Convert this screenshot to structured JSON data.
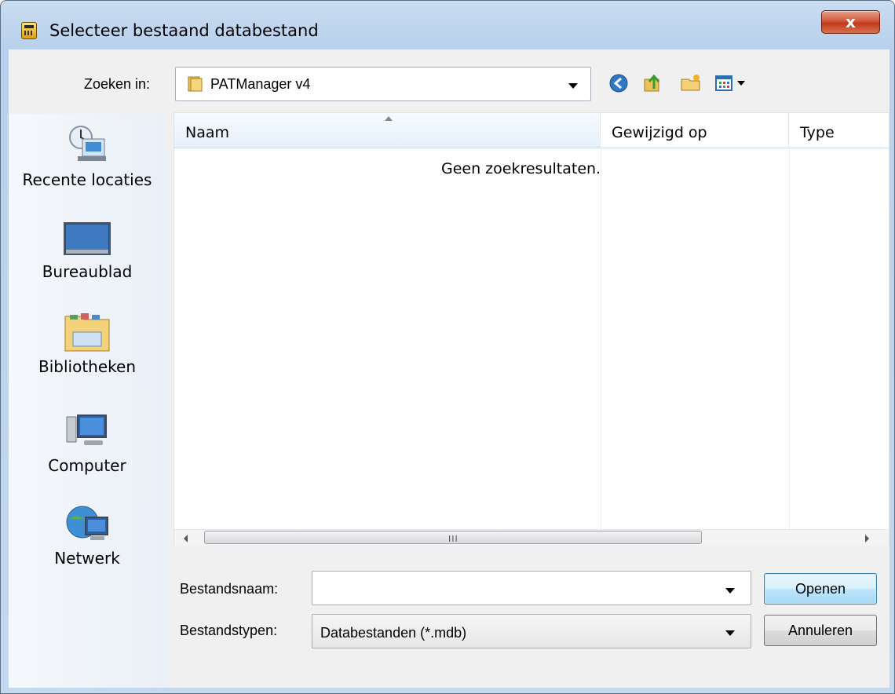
{
  "window": {
    "title": "Selecteer bestaand databestand",
    "close_label": "x"
  },
  "toolbar": {
    "lookin_label": "Zoeken in:",
    "lookin_value": "PATManager v4",
    "icons": [
      "back-icon",
      "up-folder-icon",
      "new-folder-icon",
      "view-menu-icon"
    ]
  },
  "places": [
    {
      "label": "Recente locaties",
      "icon": "recent-places-icon"
    },
    {
      "label": "Bureaublad",
      "icon": "desktop-icon"
    },
    {
      "label": "Bibliotheken",
      "icon": "libraries-icon"
    },
    {
      "label": "Computer",
      "icon": "computer-icon"
    },
    {
      "label": "Netwerk",
      "icon": "network-icon"
    }
  ],
  "list": {
    "columns": [
      "Naam",
      "Gewijzigd op",
      "Type"
    ],
    "sorted_column": "Naam",
    "empty_message": "Geen zoekresultaten.",
    "scroll_grip": "III"
  },
  "form": {
    "filename_label": "Bestandsnaam:",
    "filename_value": "",
    "filetype_label": "Bestandstypen:",
    "filetype_value": "Databestanden (*.mdb)"
  },
  "buttons": {
    "open": "Openen",
    "cancel": "Annuleren"
  }
}
